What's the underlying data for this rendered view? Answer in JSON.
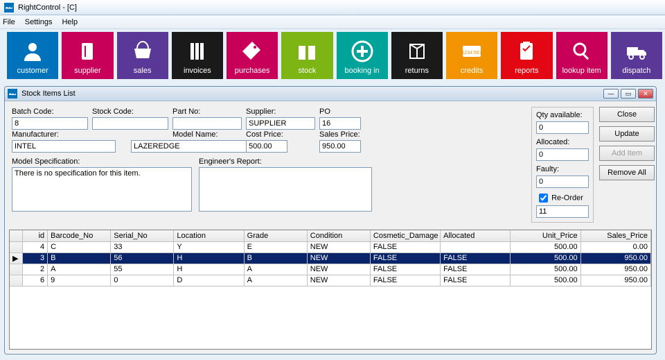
{
  "window": {
    "title": "RightControl - [C]"
  },
  "menu": {
    "file": "File",
    "settings": "Settings",
    "help": "Help"
  },
  "toolbar": {
    "items": [
      {
        "label": "customer",
        "color": "#0072bc",
        "icon": "customer"
      },
      {
        "label": "supplier",
        "color": "#c8005a",
        "icon": "supplier"
      },
      {
        "label": "sales",
        "color": "#5a3897",
        "icon": "basket"
      },
      {
        "label": "invoices",
        "color": "#1a1a1a",
        "icon": "books"
      },
      {
        "label": "purchases",
        "color": "#c8005a",
        "icon": "tag"
      },
      {
        "label": "stock",
        "color": "#7cb514",
        "icon": "gift"
      },
      {
        "label": "booking in",
        "color": "#00a39a",
        "icon": "plus"
      },
      {
        "label": "returns",
        "color": "#1a1a1a",
        "icon": "box"
      },
      {
        "label": "credits",
        "color": "#f29400",
        "icon": "card"
      },
      {
        "label": "reports",
        "color": "#e30613",
        "icon": "clipboard"
      },
      {
        "label": "lookup item",
        "color": "#c8005a",
        "icon": "search"
      },
      {
        "label": "dispatch",
        "color": "#5a3897",
        "icon": "truck"
      }
    ]
  },
  "child": {
    "title": "Stock Items List"
  },
  "labels": {
    "batch_code": "Batch Code:",
    "stock_code": "Stock Code:",
    "part_no": "Part No:",
    "supplier": "Supplier:",
    "po_number": "PO Number:",
    "manufacturer": "Manufacturer:",
    "model_name": "Model Name:",
    "cost_price": "Cost Price:",
    "sales_price": "Sales Price:",
    "model_spec": "Model Specification:",
    "eng_report": "Engineer's Report:",
    "qty": "Qty available:",
    "allocated": "Allocated:",
    "faulty": "Faulty:",
    "reorder": "Re-Order"
  },
  "values": {
    "batch_code": "8",
    "stock_code": "",
    "part_no": "",
    "supplier": "SUPPLIER",
    "po_number": "16",
    "manufacturer": "INTEL",
    "model_name": "LAZEREDGE",
    "cost_price": "500.00",
    "sales_price": "950.00",
    "model_spec": "There is no specification for this item.",
    "eng_report": "",
    "qty": "0",
    "allocated": "0",
    "faulty": "0",
    "reorder_qty": "11",
    "reorder_checked": true
  },
  "buttons": {
    "close": "Close",
    "update": "Update",
    "add": "Add Item",
    "remove": "Remove All"
  },
  "grid": {
    "headers": [
      "id",
      "Barcode_No",
      "Serial_No",
      "Location",
      "Grade",
      "Condition",
      "Cosmetic_Damage",
      "Allocated",
      "Unit_Price",
      "Sales_Price"
    ],
    "widths": [
      36,
      90,
      90,
      100,
      90,
      90,
      100,
      100,
      100,
      100
    ],
    "rows": [
      {
        "sel": false,
        "c": [
          "4",
          "C",
          "33",
          "Y",
          "E",
          "NEW",
          "FALSE",
          "",
          "500.00",
          "0.00"
        ]
      },
      {
        "sel": true,
        "c": [
          "3",
          "B",
          "56",
          "H",
          "B",
          "NEW",
          "FALSE",
          "FALSE",
          "500.00",
          "950.00"
        ]
      },
      {
        "sel": false,
        "c": [
          "2",
          "A",
          "55",
          "H",
          "A",
          "NEW",
          "FALSE",
          "FALSE",
          "500.00",
          "950.00"
        ]
      },
      {
        "sel": false,
        "c": [
          "6",
          "9",
          "0",
          "D",
          "A",
          "NEW",
          "FALSE",
          "FALSE",
          "500.00",
          "950.00"
        ]
      }
    ]
  }
}
